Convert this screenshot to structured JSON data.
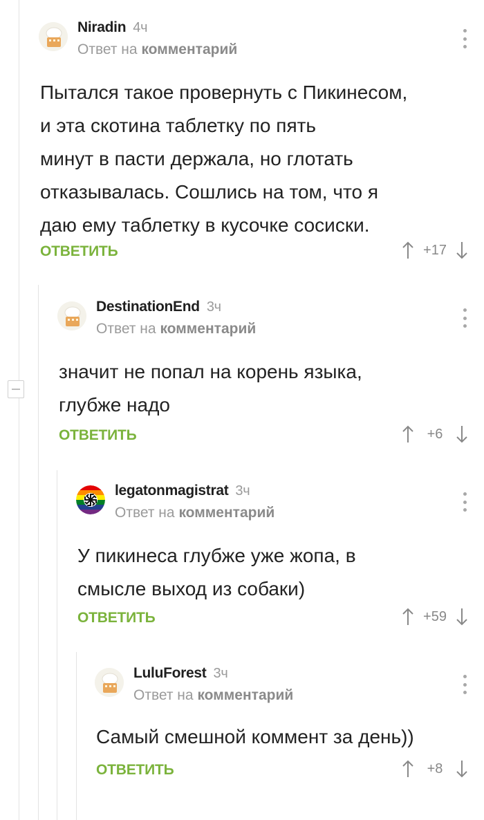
{
  "comments": [
    {
      "author": "Niradin",
      "time": "4ч",
      "reply_prefix": "Ответ на",
      "reply_target": "комментарий",
      "lines": [
        "Пытался такое провернуть с Пикинесом,",
        "и эта скотина таблетку по пять",
        "минут в пасти держала, но глотать",
        "отказывалась. Сошлись на том, что я",
        "даю ему таблетку в кусочке сосиски."
      ],
      "reply_label": "ОТВЕТИТЬ",
      "score": "+17",
      "avatar": "chef-hat-avatar"
    },
    {
      "author": "DestinationEnd",
      "time": "3ч",
      "reply_prefix": "Ответ на",
      "reply_target": "комментарий",
      "lines": [
        "значит не попал на корень языка,",
        "глубже надо"
      ],
      "reply_label": "ОТВЕТИТЬ",
      "score": "+6",
      "avatar": "chef-hat-avatar"
    },
    {
      "author": "legatonmagistrat",
      "time": "3ч",
      "reply_prefix": "Ответ на",
      "reply_target": "комментарий",
      "lines": [
        "У пикинеса глубже уже жопа, в",
        "смысле выход из собаки)"
      ],
      "reply_label": "ОТВЕТИТЬ",
      "score": "+59",
      "avatar": "rainbow-kolovrat-avatar"
    },
    {
      "author": "LuluForest",
      "time": "3ч",
      "reply_prefix": "Ответ на",
      "reply_target": "комментарий",
      "lines": [
        "Самый смешной коммент за день))"
      ],
      "reply_label": "ОТВЕТИТЬ",
      "score": "+8",
      "avatar": "chef-hat-avatar"
    }
  ],
  "colors": {
    "reply_green": "#7bb33c",
    "meta_gray": "#9a9a9a",
    "thread_line": "#e3e3e3"
  }
}
